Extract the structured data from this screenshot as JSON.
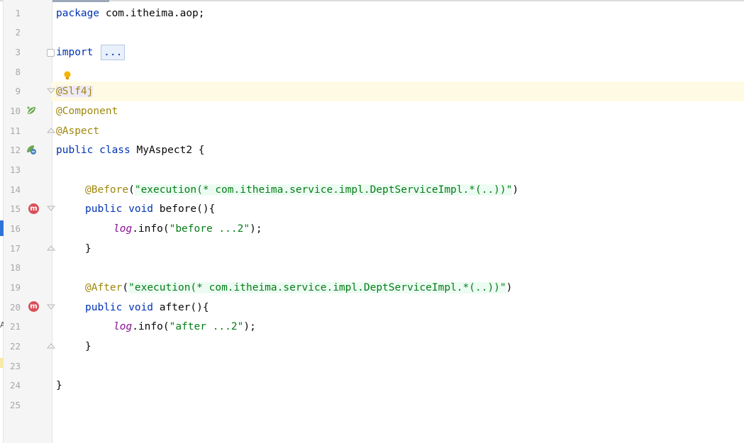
{
  "editor": {
    "lines": [
      {
        "n": "1",
        "text": "package com.itheima.aop;"
      },
      {
        "n": "2",
        "text": ""
      },
      {
        "n": "3",
        "kw": "import",
        "fold": "..."
      },
      {
        "n": "8",
        "text": ""
      },
      {
        "n": "9",
        "ann": "@Slf4j"
      },
      {
        "n": "10",
        "ann": "@Component"
      },
      {
        "n": "11",
        "ann": "@Aspect"
      },
      {
        "n": "12",
        "text": "public class MyAspect2 {"
      },
      {
        "n": "13",
        "text": ""
      },
      {
        "n": "14",
        "ann": "@Before",
        "str": "\"execution(* com.itheima.service.impl.DeptServiceImpl.*(..))\"",
        "tail": ")"
      },
      {
        "n": "15",
        "text": "public void before(){"
      },
      {
        "n": "16",
        "field": "log",
        "call": ".info(",
        "str": "\"before ...2\"",
        "tail": ");"
      },
      {
        "n": "17",
        "text": "}"
      },
      {
        "n": "18",
        "text": ""
      },
      {
        "n": "19",
        "ann": "@After",
        "str": "\"execution(* com.itheima.service.impl.DeptServiceImpl.*(..))\"",
        "tail": ")"
      },
      {
        "n": "20",
        "text": "public void after(){"
      },
      {
        "n": "21",
        "field": "log",
        "call": ".info(",
        "str": "\"after ...2\"",
        "tail": ");"
      },
      {
        "n": "22",
        "text": "}"
      },
      {
        "n": "23",
        "text": ""
      },
      {
        "n": "24",
        "text": "}"
      },
      {
        "n": "25",
        "text": ""
      }
    ]
  },
  "gutter_icons": {
    "bulb": "lightbulb-icon",
    "bean": "spring-bean-icon",
    "aspect": "spring-aspect-icon",
    "method_marker": "m",
    "side_letter": "A"
  },
  "colors": {
    "keyword": "#0033b3",
    "annotation": "#9e880d",
    "string": "#067d17",
    "field": "#871094",
    "caret_line": "#fffae3"
  }
}
